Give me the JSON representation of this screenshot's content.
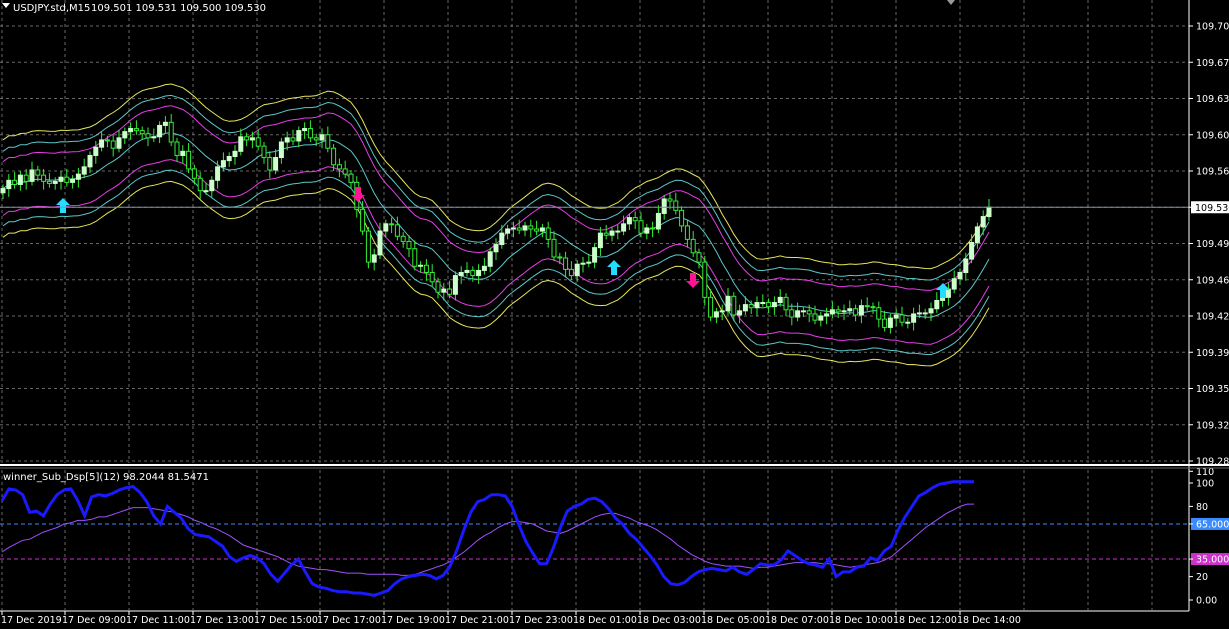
{
  "header": {
    "symbol_timeframe": "USDJPY.std,M15",
    "ohlc": "109.501 109.531 109.500 109.530"
  },
  "indicator_header": "winner_Sub_Dsp[5](12) 98.2044 81.5471",
  "colors": {
    "background": "#000000",
    "bull_candle": "#ccffcc",
    "wick": "#33ee33",
    "band_outer": "#ffff66",
    "band_middle": "#ff44ff",
    "band_inner": "#66dddd",
    "up_arrow": "#22ddff",
    "down_arrow": "#ff1493",
    "oscillator_main": "#1a1aff",
    "oscillator_signal": "#a050ff",
    "level_65": "#3a8aff",
    "level_35": "#cc33cc"
  },
  "chart_data": [
    {
      "type": "candlestick",
      "title": "USDJPY.std,M15",
      "ylim": [
        109.27,
        109.72
      ],
      "y_ticks": [
        "109.705",
        "109.670",
        "109.635",
        "109.600",
        "109.565",
        "109.530",
        "109.495",
        "109.460",
        "109.425",
        "109.390",
        "109.355",
        "109.320",
        "109.285"
      ],
      "current_price": "109.530",
      "grid": true,
      "close": [
        109.548,
        109.556,
        109.552,
        109.561,
        109.555,
        109.566,
        109.561,
        109.555,
        109.553,
        109.555,
        109.559,
        109.554,
        109.557,
        109.562,
        109.569,
        109.58,
        109.588,
        109.595,
        109.594,
        109.587,
        109.597,
        109.603,
        109.606,
        109.604,
        109.601,
        109.597,
        109.598,
        109.609,
        109.612,
        109.593,
        109.58,
        109.584,
        109.567,
        109.558,
        109.546,
        109.546,
        109.556,
        109.569,
        109.575,
        109.579,
        109.584,
        109.598,
        109.595,
        109.597,
        109.589,
        109.578,
        109.566,
        109.578,
        109.593,
        109.597,
        109.594,
        109.604,
        109.606,
        109.597,
        109.595,
        109.6,
        109.587,
        109.571,
        109.567,
        109.562,
        109.554,
        109.528,
        109.507,
        109.477,
        109.484,
        109.507,
        109.514,
        109.513,
        109.502,
        109.497,
        109.49,
        109.473,
        109.474,
        109.467,
        109.458,
        109.448,
        109.451,
        109.446,
        109.464,
        109.467,
        109.469,
        109.464,
        109.469,
        109.473,
        109.487,
        109.494,
        109.505,
        109.509,
        109.51,
        109.508,
        109.512,
        109.509,
        109.507,
        109.51,
        109.499,
        109.482,
        109.481,
        109.47,
        109.464,
        109.475,
        109.476,
        109.477,
        109.491,
        109.505,
        109.503,
        109.507,
        109.507,
        109.514,
        109.52,
        109.517,
        109.505,
        109.51,
        109.509,
        109.524,
        109.538,
        109.536,
        109.527,
        109.512,
        109.499,
        109.486,
        109.477,
        109.443,
        109.424,
        109.429,
        109.43,
        109.444,
        109.426,
        109.43,
        109.436,
        109.433,
        109.438,
        109.438,
        109.434,
        109.438,
        109.443,
        109.431,
        109.424,
        109.43,
        109.43,
        109.427,
        109.421,
        109.425,
        109.427,
        109.431,
        109.429,
        109.43,
        109.432,
        109.426,
        109.435,
        109.434,
        109.433,
        109.422,
        109.414,
        109.423,
        109.426,
        109.419,
        109.419,
        109.427,
        109.428,
        109.428,
        109.432,
        109.44,
        109.443,
        109.451,
        109.461,
        109.467,
        109.48,
        109.496,
        109.511,
        109.521,
        109.53
      ]
    },
    {
      "type": "line",
      "title": "winner_Sub_Dsp[5](12)",
      "ylim": [
        0,
        110
      ],
      "y_ticks": [
        "110",
        "100",
        "80",
        "65.0000",
        "35.0000",
        "20",
        "0.00"
      ],
      "levels": [
        65,
        35
      ],
      "x_labels": [
        "17 Dec 2019",
        "17 Dec 09:00",
        "17 Dec 11:00",
        "17 Dec 13:00",
        "17 Dec 15:00",
        "17 Dec 17:00",
        "17 Dec 19:00",
        "17 Dec 21:00",
        "17 Dec 23:00",
        "18 Dec 01:00",
        "18 Dec 03:00",
        "18 Dec 05:00",
        "18 Dec 07:00",
        "18 Dec 10:00",
        "18 Dec 12:00",
        "18 Dec 14:00"
      ],
      "series": [
        {
          "values": [
            85,
            95,
            94,
            90,
            75,
            76,
            72,
            82,
            90,
            94,
            95,
            85,
            72,
            88,
            90,
            89,
            91,
            94,
            96,
            97,
            92,
            84,
            72,
            65,
            80,
            75,
            70,
            61,
            56,
            55,
            54,
            50,
            46,
            37,
            33,
            36,
            38,
            36,
            31,
            22,
            16,
            23,
            30,
            35,
            24,
            14,
            11,
            10,
            8,
            7,
            7,
            6,
            6,
            5,
            4,
            6,
            8,
            14,
            18,
            20,
            21,
            22,
            21,
            18,
            21,
            29,
            43,
            60,
            75,
            84,
            86,
            90,
            90,
            89,
            80,
            64,
            50,
            40,
            31,
            31,
            45,
            62,
            76,
            80,
            82,
            86,
            87,
            84,
            78,
            70,
            65,
            57,
            52,
            45,
            38,
            30,
            20,
            14,
            13,
            15,
            20,
            24,
            26,
            27,
            26,
            25,
            28,
            24,
            22,
            26,
            31,
            30,
            30,
            34,
            42,
            38,
            34,
            31,
            30,
            28,
            35,
            20,
            24,
            24,
            28,
            29,
            36,
            34,
            42,
            46,
            60,
            71,
            80,
            89,
            92,
            96,
            99,
            100,
            101,
            101,
            101,
            101
          ]
        },
        {
          "values": [
            41,
            45,
            48,
            51,
            52,
            55,
            58,
            60,
            62,
            65,
            66,
            68,
            68,
            69,
            71,
            71,
            73,
            75,
            77,
            79,
            79,
            79,
            78,
            77,
            76,
            75,
            73,
            71,
            68,
            66,
            63,
            61,
            58,
            55,
            51,
            47,
            45,
            43,
            41,
            39,
            37,
            34,
            31,
            29,
            28,
            27,
            26,
            26,
            25,
            24,
            23,
            23,
            23,
            22,
            22,
            22,
            22,
            22,
            21,
            21,
            22,
            24,
            26,
            28,
            30,
            33,
            37,
            41,
            46,
            51,
            55,
            58,
            62,
            65,
            67,
            67,
            66,
            65,
            62,
            59,
            58,
            57,
            59,
            62,
            65,
            68,
            71,
            73,
            74,
            74,
            72,
            70,
            67,
            65,
            63,
            60,
            56,
            52,
            47,
            43,
            39,
            36,
            33,
            31,
            30,
            29,
            29,
            29,
            28,
            27,
            28,
            28,
            29,
            30,
            31,
            32,
            32,
            32,
            32,
            31,
            31,
            30,
            29,
            28,
            29,
            30,
            31,
            32,
            34,
            37,
            42,
            47,
            52,
            57,
            62,
            66,
            70,
            74,
            77,
            80,
            82,
            82
          ]
        }
      ]
    }
  ]
}
